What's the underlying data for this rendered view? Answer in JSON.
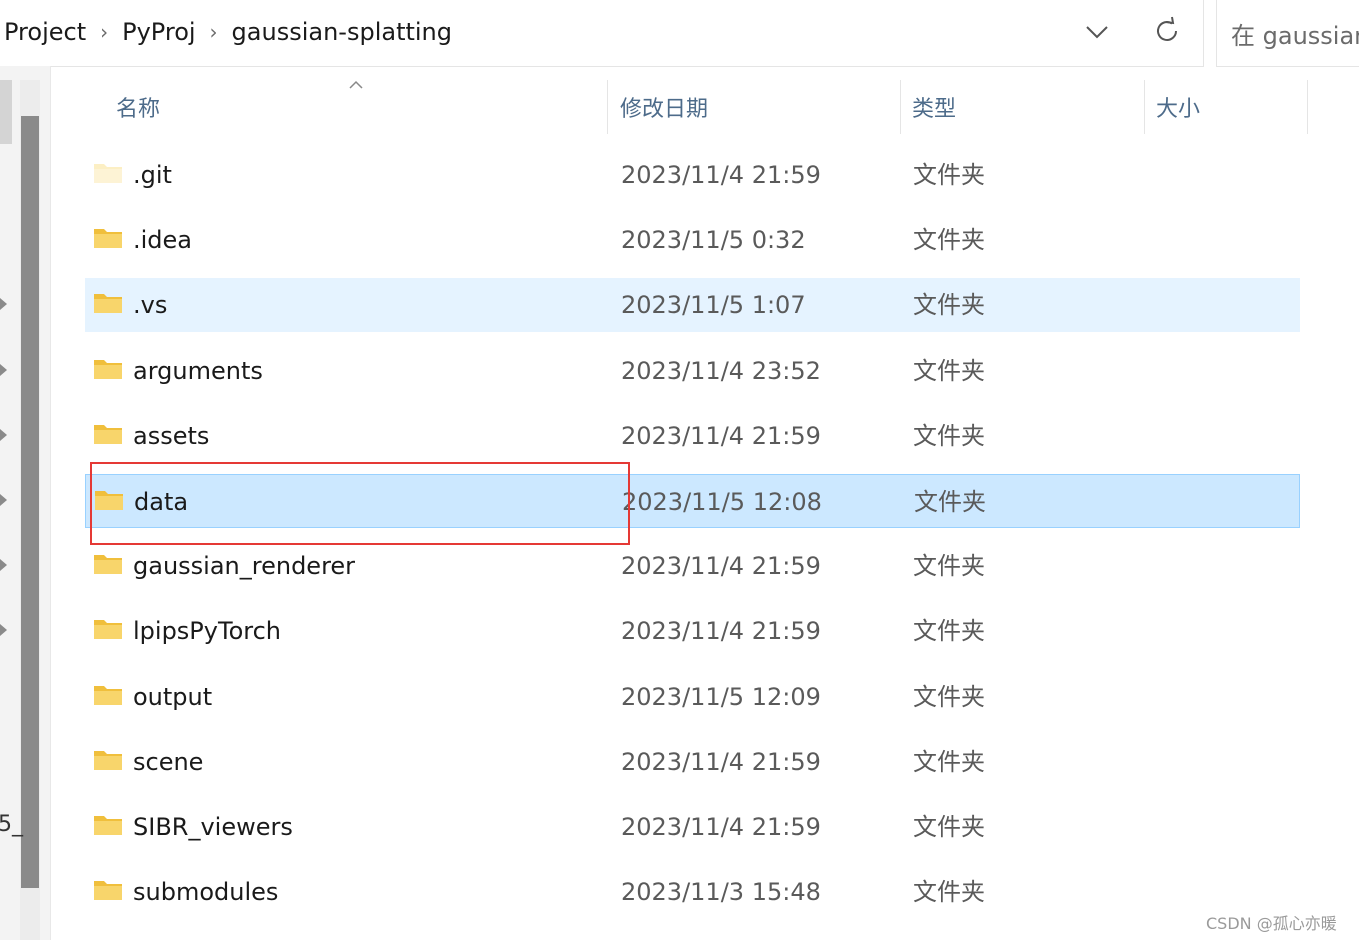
{
  "breadcrumb": [
    "Project",
    "PyProj",
    "gaussian-splatting"
  ],
  "search": {
    "placeholder": "在 gaussian"
  },
  "columns": {
    "name": "名称",
    "date": "修改日期",
    "type": "类型",
    "size": "大小"
  },
  "files": [
    {
      "name": ".git",
      "date": "2023/11/4 21:59",
      "type": "文件夹",
      "faded": true
    },
    {
      "name": ".idea",
      "date": "2023/11/5 0:32",
      "type": "文件夹"
    },
    {
      "name": ".vs",
      "date": "2023/11/5 1:07",
      "type": "文件夹",
      "state": "hover"
    },
    {
      "name": "arguments",
      "date": "2023/11/4 23:52",
      "type": "文件夹"
    },
    {
      "name": "assets",
      "date": "2023/11/4 21:59",
      "type": "文件夹"
    },
    {
      "name": "data",
      "date": "2023/11/5 12:08",
      "type": "文件夹",
      "state": "selected"
    },
    {
      "name": "gaussian_renderer",
      "date": "2023/11/4 21:59",
      "type": "文件夹"
    },
    {
      "name": "lpipsPyTorch",
      "date": "2023/11/4 21:59",
      "type": "文件夹"
    },
    {
      "name": "output",
      "date": "2023/11/5 12:09",
      "type": "文件夹"
    },
    {
      "name": "scene",
      "date": "2023/11/4 21:59",
      "type": "文件夹"
    },
    {
      "name": "SIBR_viewers",
      "date": "2023/11/4 21:59",
      "type": "文件夹"
    },
    {
      "name": "submodules",
      "date": "2023/11/3 15:48",
      "type": "文件夹"
    }
  ],
  "nav_cut_text": "5_",
  "watermark": "CSDN @孤心亦暖",
  "colors": {
    "hover": "#e5f3ff",
    "selected": "#cce8ff",
    "selected_border": "#99d1ff",
    "annotation": "#e53935",
    "folder": "#f8d56b"
  }
}
